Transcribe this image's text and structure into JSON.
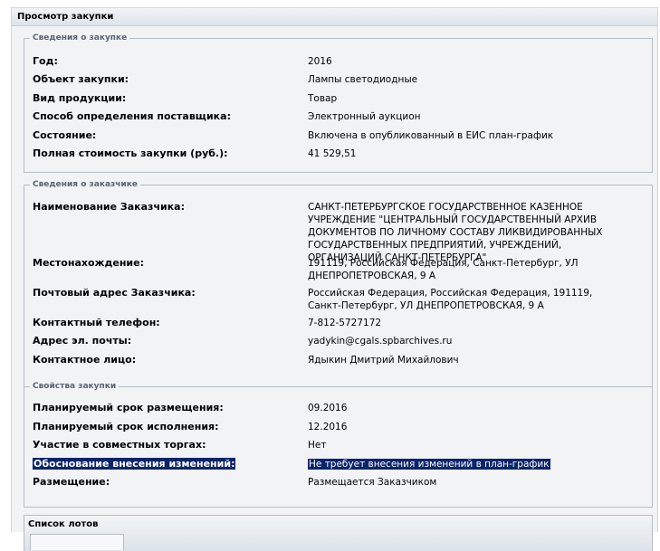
{
  "window": {
    "title": "Просмотр закупки"
  },
  "purchase": {
    "legend": "Сведения о закупке",
    "fields": [
      {
        "label": "Год:",
        "value": "2016"
      },
      {
        "label": "Объект закупки:",
        "value": "Лампы светодиодные"
      },
      {
        "label": "Вид продукции:",
        "value": "Товар"
      },
      {
        "label": "Способ определения поставщика:",
        "value": "Электронный аукцион"
      },
      {
        "label": "Состояние:",
        "value": "Включена в опубликованный в ЕИС план-график"
      },
      {
        "label": "Полная стоимость закупки (руб.):",
        "value": "41 529,51"
      }
    ]
  },
  "customer": {
    "legend": "Сведения о заказчике",
    "fields": [
      {
        "label": "Наименование Заказчика:",
        "value": "САНКТ-ПЕТЕРБУРГСКОЕ ГОСУДАРСТВЕННОЕ КАЗЕННОЕ УЧРЕЖДЕНИЕ \"ЦЕНТРАЛЬНЫЙ ГОСУДАРСТВЕННЫЙ АРХИВ ДОКУМЕНТОВ ПО ЛИЧНОМУ СОСТАВУ ЛИКВИДИРОВАННЫХ ГОСУДАРСТВЕННЫХ ПРЕДПРИЯТИЙ, УЧРЕЖДЕНИЙ, ОРГАНИЗАЦИЙ САНКТ-ПЕТЕРБУРГА\""
      },
      {
        "label": "Местонахождение:",
        "value": "191119, Российская Федерация, Санкт-Петербург, УЛ ДНЕПРОПЕТРОВСКАЯ, 9 А"
      },
      {
        "label": "Почтовый адрес Заказчика:",
        "value": "Российская Федерация, Российская Федерация, 191119, Санкт-Петербург, УЛ ДНЕПРОПЕТРОВСКАЯ, 9 А"
      },
      {
        "label": "Контактный телефон:",
        "value": "7-812-5727172"
      },
      {
        "label": "Адрес эл. почты:",
        "value": "yadykin@cgals.spbarchives.ru"
      },
      {
        "label": "Контактное лицо:",
        "value": "Ядыкин Дмитрий Михайлович"
      }
    ]
  },
  "properties": {
    "legend": "Свойства закупки",
    "fields": [
      {
        "label": "Планируемый срок размещения:",
        "value": "09.2016"
      },
      {
        "label": "Планируемый срок исполнения:",
        "value": "12.2016"
      },
      {
        "label": "Участие в совместных торгах:",
        "value": "Нет"
      },
      {
        "label": "Обоснование внесения изменений:",
        "value": "Не требует внесения изменений в план-график"
      },
      {
        "label": "Размещение:",
        "value": "Размещается Заказчиком"
      }
    ]
  },
  "lots": {
    "title": "Список лотов"
  }
}
